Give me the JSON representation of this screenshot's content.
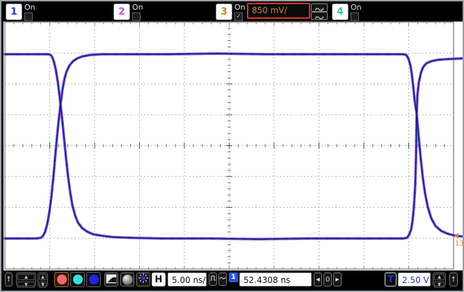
{
  "channels": [
    {
      "digit": "1",
      "state_label": "On",
      "color": "#2a3ad0",
      "check_glyph": ""
    },
    {
      "digit": "2",
      "state_label": "On",
      "color": "#cf4fcf",
      "check_glyph": ""
    },
    {
      "digit": "3",
      "state_label": "On",
      "color": "#c8882a",
      "check_glyph": "✓",
      "scale_value": "850 mV/"
    },
    {
      "digit": "4",
      "state_label": "On",
      "color": "#36c8ae",
      "check_glyph": ""
    }
  ],
  "horizontal": {
    "label": "H",
    "scale": "5.00 ns/",
    "position": "52.4308 ns",
    "trigger_source_flag": "1",
    "nudge_left": "◀",
    "nudge_zero": "0",
    "nudge_right": "▶"
  },
  "trigger": {
    "label": "T",
    "level": "2.50 V",
    "accent": "#2233cc",
    "slope_arrow": "↑"
  },
  "toolbar": {
    "run_arrow": "↑",
    "spin_up": "▲",
    "spin_down": "▼",
    "marker_colors": {
      "red": "#ef6a6a",
      "cyan": "#35e0e0",
      "blue": "#2323e0"
    }
  },
  "display": {
    "marker": {
      "arrow": "◄",
      "label": "13",
      "color": "#c8882a"
    },
    "waveform": {
      "colors": {
        "fringe": "#9a4fd6",
        "core": "#2e3ed2",
        "dark": "#0d1050",
        "fleck": "#1c6b2c"
      },
      "trace_a": [
        [
          5,
          76
        ],
        [
          30,
          76
        ],
        [
          55,
          76
        ],
        [
          68,
          76
        ],
        [
          72,
          78
        ],
        [
          75,
          85
        ],
        [
          78,
          97
        ],
        [
          81,
          115
        ],
        [
          83,
          131
        ],
        [
          85,
          148
        ],
        [
          87,
          166
        ],
        [
          90,
          196
        ],
        [
          93,
          226
        ],
        [
          96,
          253
        ],
        [
          99,
          275
        ],
        [
          102,
          293
        ],
        [
          106,
          308
        ],
        [
          110,
          318
        ],
        [
          116,
          326
        ],
        [
          123,
          331
        ],
        [
          132,
          335
        ],
        [
          144,
          337
        ],
        [
          160,
          339
        ],
        [
          185,
          340
        ],
        [
          230,
          341
        ],
        [
          300,
          341
        ],
        [
          370,
          342
        ],
        [
          440,
          341
        ],
        [
          510,
          341
        ],
        [
          560,
          341
        ],
        [
          578,
          341
        ],
        [
          583,
          340
        ],
        [
          586,
          336
        ],
        [
          589,
          328
        ],
        [
          591,
          316
        ],
        [
          593,
          296
        ],
        [
          595,
          262
        ],
        [
          596,
          225
        ],
        [
          597,
          162
        ],
        [
          598,
          135
        ],
        [
          600,
          117
        ],
        [
          603,
          103
        ],
        [
          606,
          95
        ],
        [
          611,
          89
        ],
        [
          618,
          86
        ],
        [
          628,
          84
        ],
        [
          642,
          83
        ],
        [
          662,
          82
        ]
      ],
      "trace_b": [
        [
          5,
          341
        ],
        [
          30,
          341
        ],
        [
          50,
          341
        ],
        [
          57,
          340
        ],
        [
          60,
          337
        ],
        [
          63,
          331
        ],
        [
          66,
          320
        ],
        [
          69,
          303
        ],
        [
          72,
          280
        ],
        [
          75,
          250
        ],
        [
          78,
          216
        ],
        [
          81,
          184
        ],
        [
          85,
          148
        ],
        [
          88,
          126
        ],
        [
          91,
          110
        ],
        [
          94,
          100
        ],
        [
          98,
          92
        ],
        [
          103,
          86
        ],
        [
          109,
          82
        ],
        [
          117,
          79
        ],
        [
          128,
          77
        ],
        [
          145,
          76
        ],
        [
          175,
          76
        ],
        [
          240,
          76
        ],
        [
          310,
          75
        ],
        [
          380,
          76
        ],
        [
          450,
          76
        ],
        [
          520,
          76
        ],
        [
          562,
          76
        ],
        [
          578,
          76
        ],
        [
          582,
          77
        ],
        [
          585,
          82
        ],
        [
          588,
          92
        ],
        [
          590,
          105
        ],
        [
          592,
          122
        ],
        [
          594,
          142
        ],
        [
          597,
          162
        ],
        [
          600,
          196
        ],
        [
          603,
          228
        ],
        [
          606,
          255
        ],
        [
          609,
          276
        ],
        [
          613,
          296
        ],
        [
          618,
          312
        ],
        [
          624,
          323
        ],
        [
          632,
          330
        ],
        [
          641,
          334
        ],
        [
          652,
          337
        ],
        [
          662,
          338
        ]
      ]
    }
  }
}
